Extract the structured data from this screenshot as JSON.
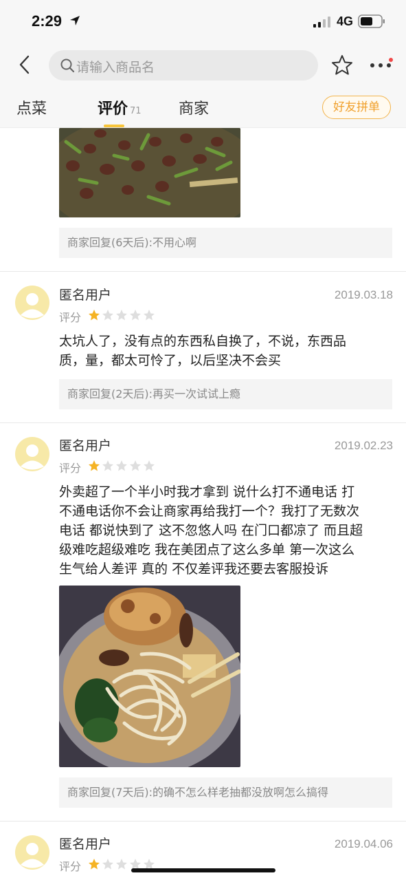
{
  "status_bar": {
    "time": "2:29",
    "network": "4G"
  },
  "search": {
    "placeholder": "请输入商品名"
  },
  "tabs": [
    {
      "label": "点菜"
    },
    {
      "label": "评价",
      "count": "71"
    },
    {
      "label": "商家"
    }
  ],
  "friend_button": "好友拼单",
  "colors": {
    "accent": "#f8c53a",
    "star_on": "#f5b324",
    "star_off": "#dedede",
    "badge": "#f04848"
  },
  "reviews": [
    {
      "reply": "商家回复(6天后):不用心啊"
    },
    {
      "user": "匿名用户",
      "date": "2019.03.18",
      "score_label": "评分",
      "rating": 1,
      "text_lines": [
        "太坑人了，没有点的东西私自换了，不说，东西品",
        "质，量，都太可怜了，以后坚决不会买"
      ],
      "reply": "商家回复(2天后):再买一次试试上瘾"
    },
    {
      "user": "匿名用户",
      "date": "2019.02.23",
      "score_label": "评分",
      "rating": 1,
      "text_lines": [
        "外卖超了一个半小时我才拿到 说什么打不通电话  打",
        "不通电话你不会让商家再给我打一个？我打了无数次",
        "电话 都说快到了 这不忽悠人吗  在门口都凉了 而且超",
        "级难吃超级难吃 我在美团点了这么多单 第一次这么",
        "生气给人差评 真的 不仅差评我还要去客服投诉"
      ],
      "reply": "商家回复(7天后):的确不怎么样老抽都没放啊怎么搞得"
    },
    {
      "user": "匿名用户",
      "date": "2019.04.06",
      "score_label": "评分",
      "rating": 1
    }
  ]
}
